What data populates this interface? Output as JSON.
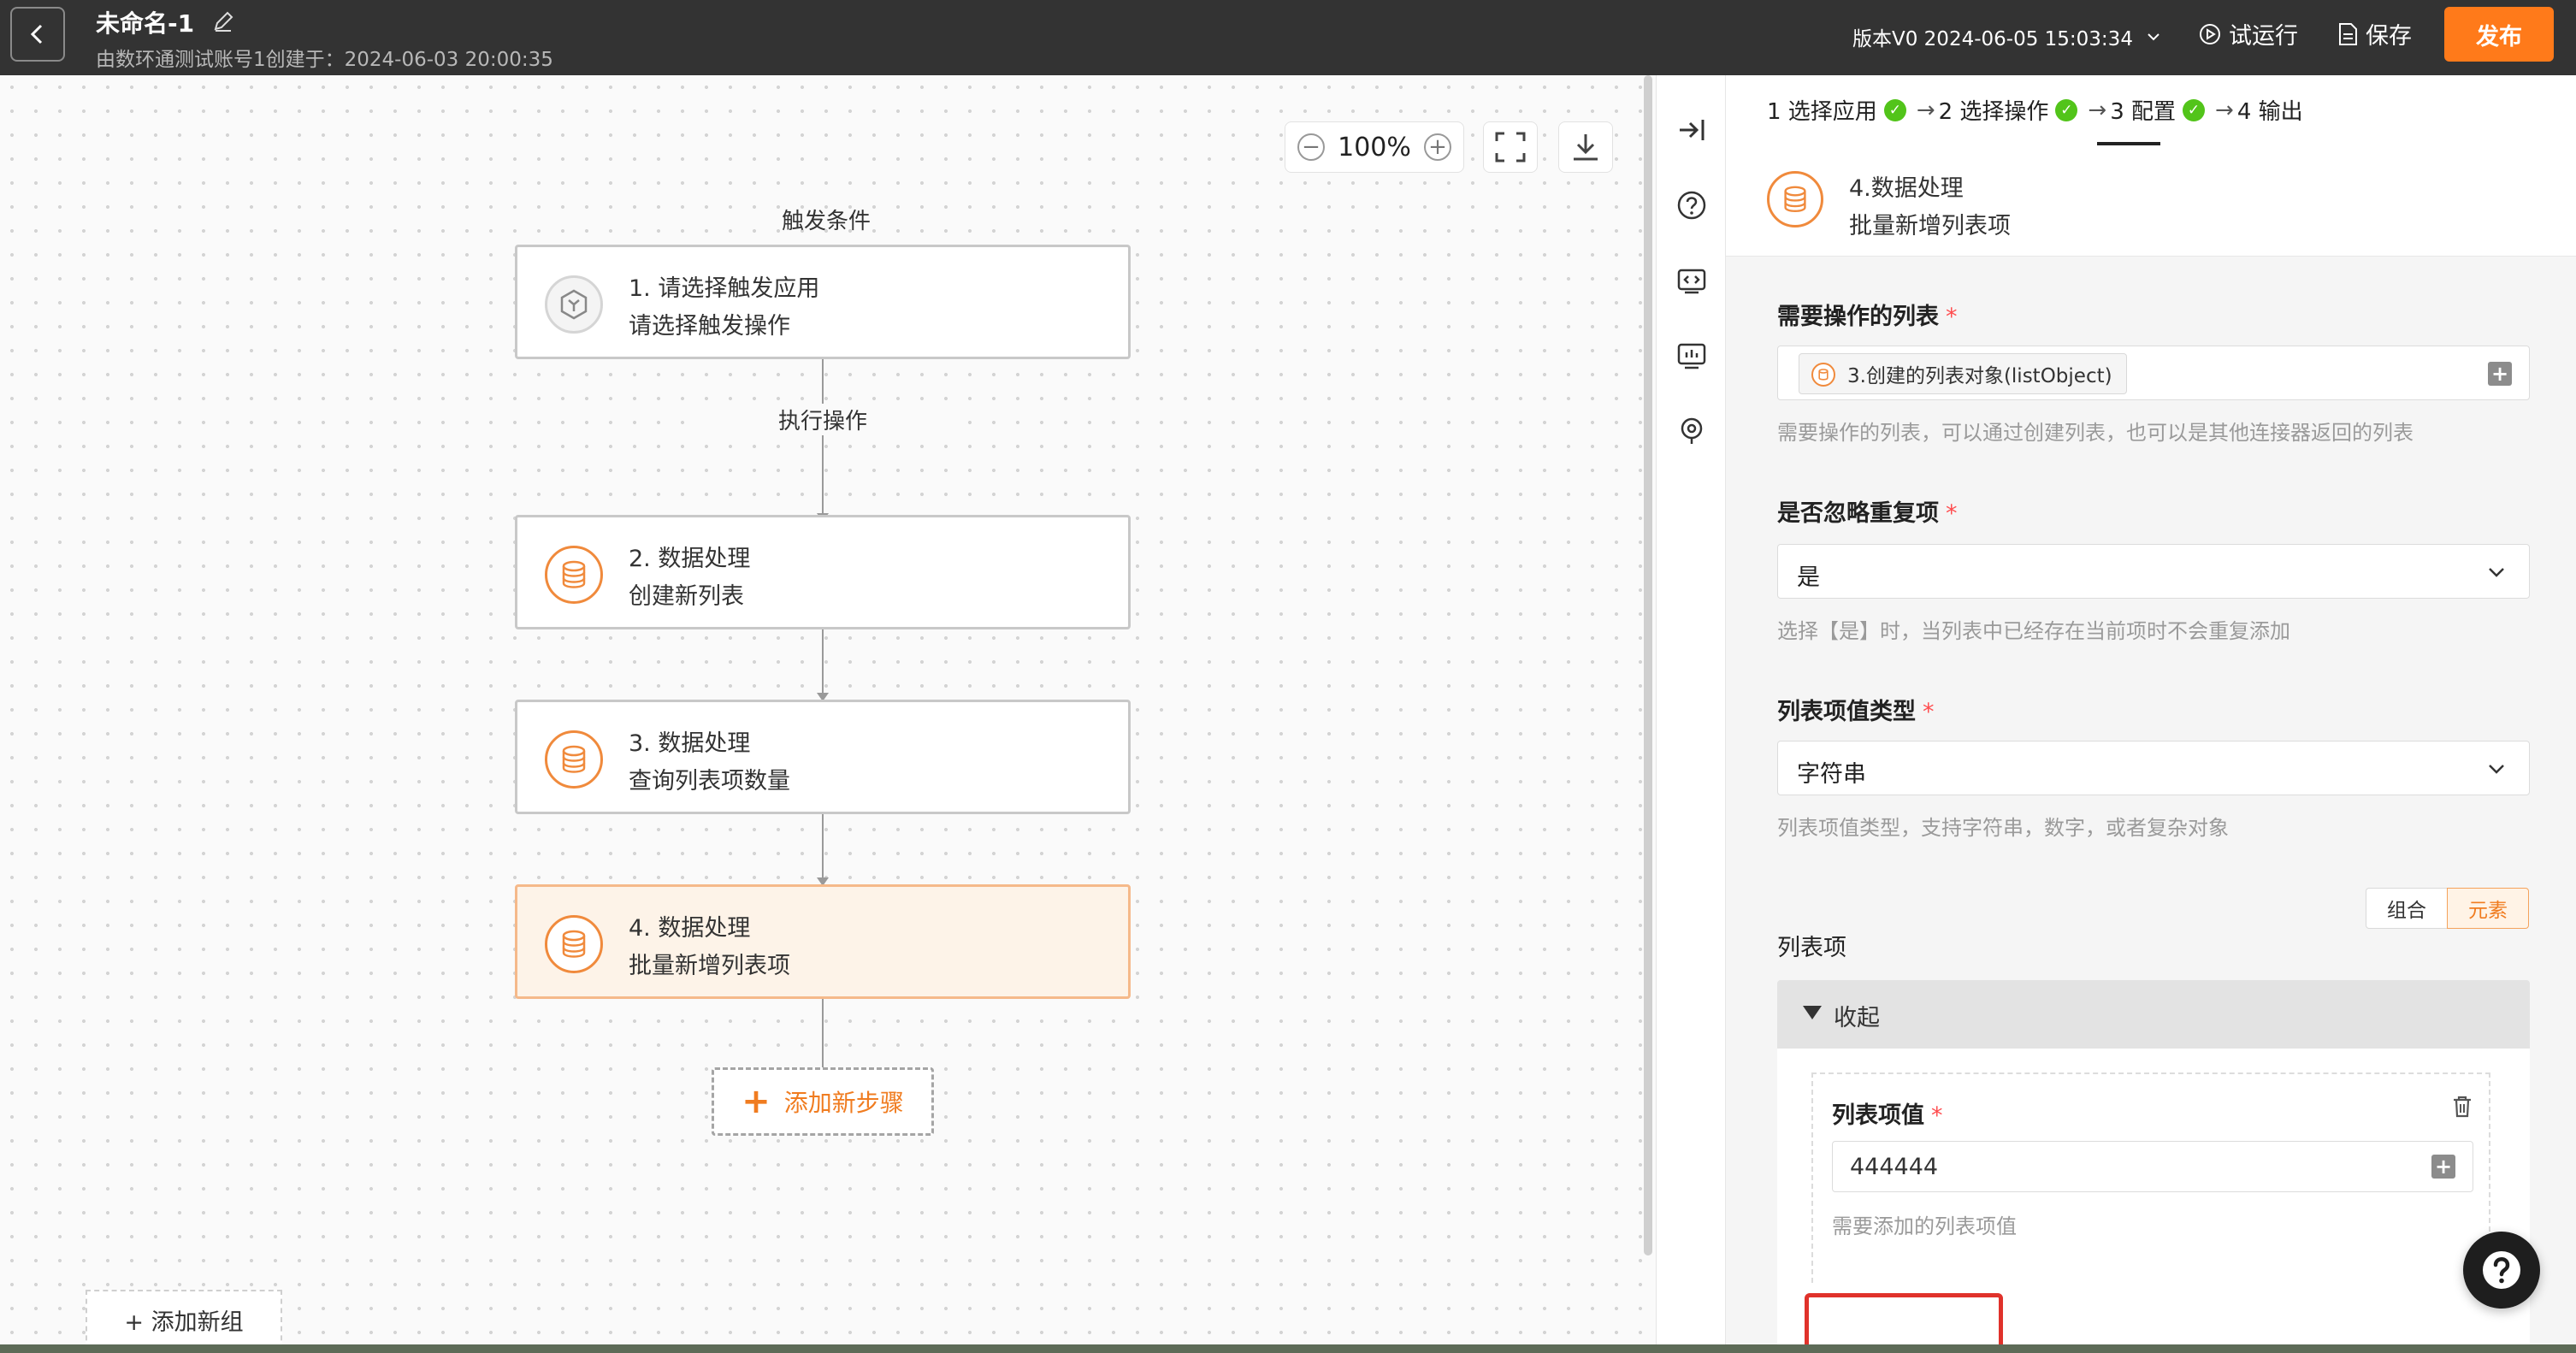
{
  "header": {
    "title": "未命名-1",
    "subtitle": "由数环通测试账号1创建于：2024-06-03 20:00:35",
    "version": "版本V0 2024-06-05 15:03:34",
    "test_run_label": "试运行",
    "save_label": "保存",
    "publish_label": "发布"
  },
  "canvas": {
    "zoom": "100%",
    "trigger_label": "触发条件",
    "action_label": "执行操作",
    "add_step_label": "添加新步骤",
    "nodes": [
      {
        "line1": "1. 请选择触发应用",
        "line2": "请选择触发操作",
        "icon": "trigger-app-icon"
      },
      {
        "line1": "2. 数据处理",
        "line2": "创建新列表",
        "icon": "database-icon"
      },
      {
        "line1": "3. 数据处理",
        "line2": "查询列表项数量",
        "icon": "database-icon"
      },
      {
        "line1": "4. 数据处理",
        "line2": "批量新增列表项",
        "icon": "database-icon"
      }
    ]
  },
  "panel": {
    "steps": [
      "1 选择应用",
      "2 选择操作",
      "3 配置",
      "4 输出"
    ],
    "operation": {
      "line1": "4.数据处理",
      "line2": "批量新增列表项"
    },
    "list_field": {
      "label": "需要操作的列表",
      "value": "3.创建的列表对象(listObject)",
      "help": "需要操作的列表，可以通过创建列表，也可以是其他连接器返回的列表"
    },
    "ignore_dup_field": {
      "label": "是否忽略重复项",
      "value": "是",
      "help": "选择【是】时，当列表中已经存在当前项时不会重复添加"
    },
    "value_type_field": {
      "label": "列表项值类型",
      "value": "字符串",
      "help": "列表项值类型，支持字符串，数字，或者复杂对象"
    },
    "mode_toggle": {
      "left": "组合",
      "right": "元素",
      "selected": "元素"
    },
    "list_items_label": "列表项",
    "collapse_label": "收起",
    "item": {
      "label": "列表项值",
      "value": "444444",
      "help": "需要添加的列表项值"
    },
    "add_group_label": "+ 添加新组"
  },
  "colors": {
    "accent": "#ff7a1a",
    "header_bg": "#333333",
    "success": "#52c41a",
    "highlight": "#e0322b"
  }
}
